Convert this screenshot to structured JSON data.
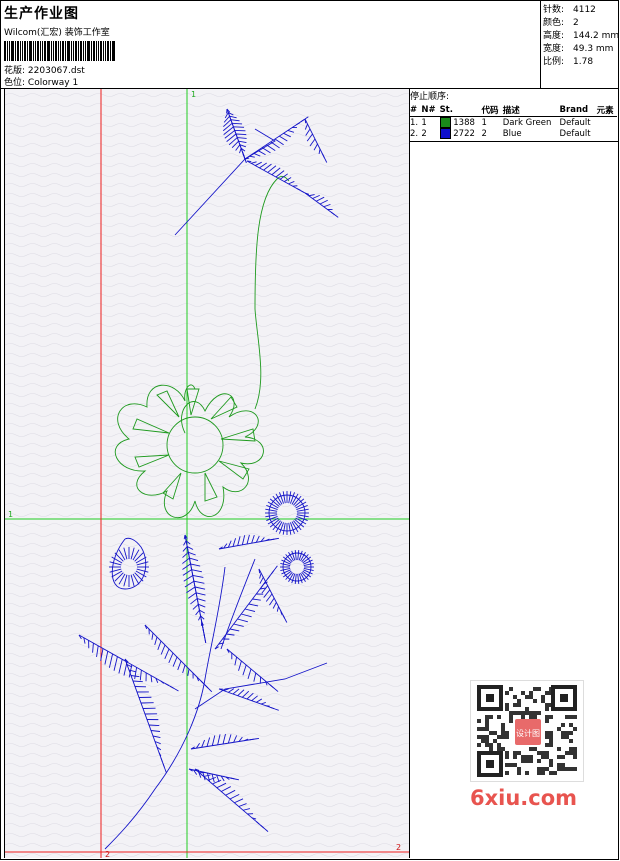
{
  "header": {
    "title": "生产作业图",
    "company": "Wilcom(汇宏) 装饰工作室",
    "design_label": "花版:",
    "design_value": "2203067.dst",
    "colorway_label": "色位:",
    "colorway_value": "Colorway 1"
  },
  "stats": [
    {
      "label": "针数:",
      "value": "4112"
    },
    {
      "label": "颜色:",
      "value": "2"
    },
    {
      "label": "高度:",
      "value": "144.2 mm"
    },
    {
      "label": "宽度:",
      "value": "49.3 mm"
    },
    {
      "label": "比例:",
      "value": "1.78"
    }
  ],
  "stop_sequence": {
    "title": "停止顺序:",
    "columns": [
      "#",
      "N#",
      "St.",
      "代码",
      "描述",
      "Brand",
      "元素"
    ],
    "rows": [
      {
        "index": "1.",
        "n": "1",
        "stitches": "1388",
        "code": "1",
        "desc": "Dark Green",
        "brand": "Default",
        "color": "#1a8a1a"
      },
      {
        "index": "2.",
        "n": "2",
        "stitches": "2722",
        "code": "2",
        "desc": "Blue",
        "brand": "Default",
        "color": "#1010cc"
      }
    ]
  },
  "canvas": {
    "guide_top": "1",
    "guide_left": "1",
    "guide_bottom": "2",
    "guide_right": "2",
    "green_color": "#22cc22",
    "red_color": "#ee1c1c",
    "thread_green": "#1e9a1e",
    "thread_blue": "#1414c8"
  },
  "watermark": {
    "text": "6xiu.com",
    "qr_label": "设计图"
  }
}
